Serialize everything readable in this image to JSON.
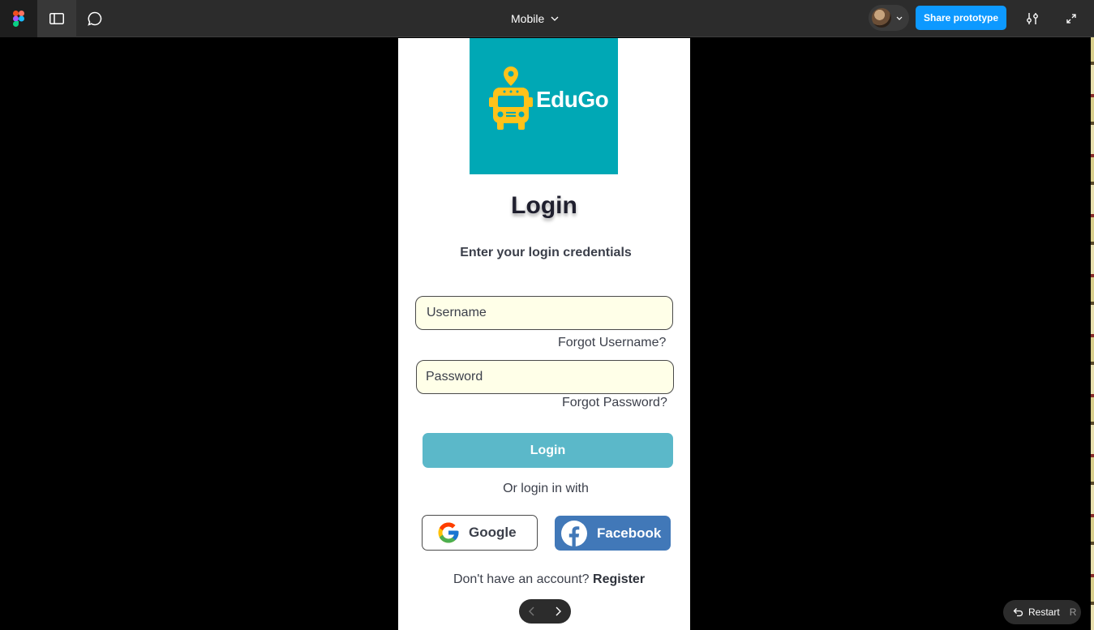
{
  "toolbar": {
    "file_title": "Mobile",
    "share_label": "Share prototype"
  },
  "screen": {
    "logo_text": "EduGo",
    "title": "Login",
    "subtitle": "Enter your login credentials",
    "username_placeholder": "Username",
    "forgot_username": "Forgot Username?",
    "password_placeholder": "Password",
    "forgot_password": "Forgot Password?",
    "login_button": "Login",
    "or_text": "Or login in with",
    "google_label": "Google",
    "facebook_label": "Facebook",
    "no_account_text": "Don't have an account?",
    "register_link": "Register"
  },
  "footer": {
    "restart_label": "Restart",
    "restart_key": "R"
  },
  "colors": {
    "accent": "#0d99ff",
    "logo_bg": "#00a8b5",
    "login_button": "#5bb8c9",
    "facebook": "#4178b8",
    "input_bg": "#ffffe8"
  }
}
